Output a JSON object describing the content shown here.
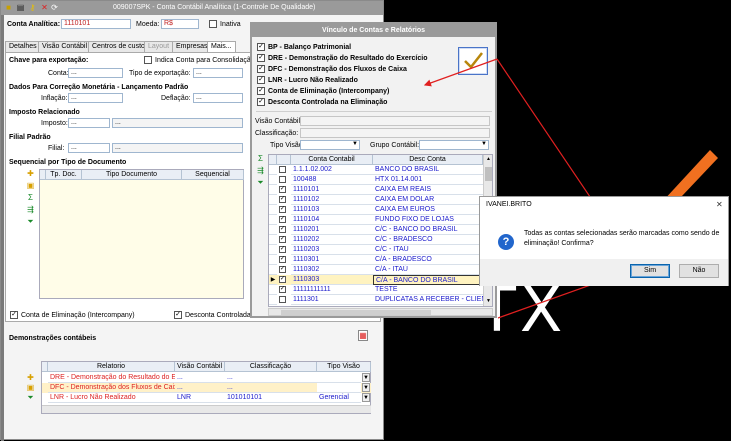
{
  "main": {
    "title": "009007SPK - Conta Contábil Analítica (1-Controle De Qualidade)",
    "conta_label": "Conta Analítica:",
    "conta_value": "1110101",
    "moeda_label": "Moeda:",
    "moeda_value": "R$",
    "inativa_label": "Inativa",
    "tabs": [
      "Detalhes",
      "Visão Contábil",
      "Centros de custo",
      "Layout",
      "Empresas",
      "Mais..."
    ],
    "sec_exportacao": "Chave para exportação:",
    "indica_label": "Indica Conta para Consolidação",
    "conta_exp_label": "Conta:",
    "conta_exp_value": "...",
    "tipo_exp_label": "Tipo de exportação:",
    "tipo_exp_value": "...",
    "sec_correcao": "Dados Para Correção Monetária - Lançamento Padrão",
    "inflacao_label": "Inflação:",
    "inflacao_value": "...",
    "deflacao_label": "Deflação:",
    "deflacao_value": "...",
    "sec_imposto": "Imposto Relacionado",
    "imposto_label": "Imposto:",
    "imposto_value": "...",
    "imposto_desc": "...",
    "sec_filial": "Filial Padrão",
    "filial_label": "Filial:",
    "filial_value": "...",
    "filial_desc": "...",
    "sec_sequencial": "Sequencial por Tipo de Documento",
    "seq_headers": [
      "Tp. Doc.",
      "Tipo Documento",
      "Sequencial"
    ],
    "conta_elim_label": "Conta de Eliminação (Intercompany)",
    "desc_controlada_label": "Desconta Controlada",
    "sec_demonstracoes": "Demonstrações contábeis",
    "dem_headers": [
      "Relatorio",
      "Visão Contábil",
      "Classificação",
      "Tipo Visão"
    ],
    "dem_rows": [
      {
        "relatorio": "DRE - Demonstração do Resultado do Ex",
        "visao": "...",
        "classificacao": "...",
        "tipo": ""
      },
      {
        "relatorio": "DFC - Demonstração dos Fluxos de Caixa",
        "visao": "...",
        "classificacao": "...",
        "tipo": ""
      },
      {
        "relatorio": "LNR - Lucro Não Realizado",
        "visao": "LNR",
        "classificacao": "101010101",
        "tipo": "Gerencial"
      }
    ]
  },
  "vinculo": {
    "title": "Vínculo de Contas e Relatórios",
    "options": [
      "BP - Balanço Patrimonial",
      "DRE - Demonstração do Resultado do Exercício",
      "DFC - Demonstração dos Fluxos de Caixa",
      "LNR - Lucro Não Realizado",
      "Conta de Eliminação (Intercompany)",
      "Desconta Controlada na Eliminação"
    ],
    "visao_label": "Visão Contábil:",
    "classificacao_label": "Classificação:",
    "tipo_visao_label": "Tipo Visão:",
    "grupo_label": "Grupo Contábil:",
    "grid_headers": [
      "Conta Contabil",
      "Desc Conta"
    ],
    "rows": [
      {
        "conta": "1.1.1.02.002",
        "desc": "BANCO DO BRASIL"
      },
      {
        "conta": "100488",
        "desc": "HTX 01.14.001"
      },
      {
        "conta": "1110101",
        "desc": "CAIXA EM REAIS"
      },
      {
        "conta": "1110102",
        "desc": "CAIXA EM DOLAR"
      },
      {
        "conta": "1110103",
        "desc": "CAIXA EM EUROS"
      },
      {
        "conta": "1110104",
        "desc": "FUNDO FIXO DE LOJAS"
      },
      {
        "conta": "1110201",
        "desc": "C/C - BANCO DO BRASIL"
      },
      {
        "conta": "1110202",
        "desc": "C/C - BRADESCO"
      },
      {
        "conta": "1110203",
        "desc": "C/C - ITAÚ"
      },
      {
        "conta": "1110301",
        "desc": "C/A - BRADESCO"
      },
      {
        "conta": "1110302",
        "desc": "C/A - ITAÚ"
      },
      {
        "conta": "1110303",
        "desc": "C/A - BANCO DO BRASIL"
      },
      {
        "conta": "11111111111",
        "desc": "TESTE"
      },
      {
        "conta": "1111301",
        "desc": "DUPLICATAS A RECEBER - CLIENTE NACI"
      }
    ]
  },
  "dialog": {
    "title": "IVANEI.BRITO",
    "message_line1": "Todas as contas selecionadas serão marcadas como sendo de",
    "message_line2": "eliminação! Confirma?",
    "yes": "Sim",
    "no": "Não",
    "close": "✕"
  },
  "background_text": "TX",
  "colors": {
    "accent": "#0a64ad",
    "link": "#1a1acc",
    "red": "#e02020",
    "row_yellow": "#fff9d6"
  }
}
